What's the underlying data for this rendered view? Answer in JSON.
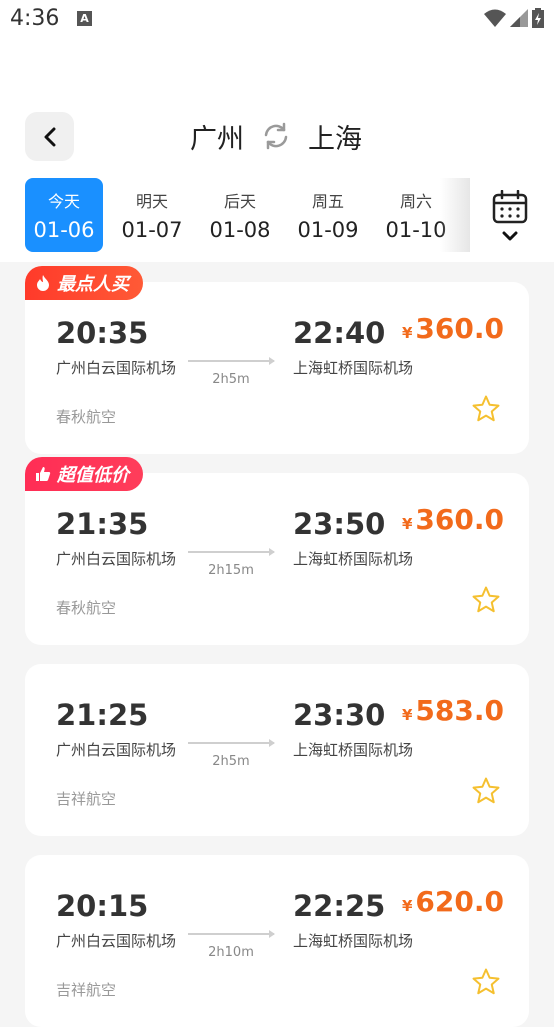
{
  "status_bar": {
    "time": "4:36",
    "notif_icon": "A"
  },
  "header": {
    "origin": "广州",
    "destination": "上海"
  },
  "date_tabs": [
    {
      "label": "今天",
      "date": "01-06",
      "active": true
    },
    {
      "label": "明天",
      "date": "01-07"
    },
    {
      "label": "后天",
      "date": "01-08"
    },
    {
      "label": "周五",
      "date": "01-09"
    },
    {
      "label": "周六",
      "date": "01-10"
    }
  ],
  "flights": [
    {
      "badge": "最点人买",
      "dep_time": "20:35",
      "arr_time": "22:40",
      "dep_airport": "广州白云国际机场",
      "arr_airport": "上海虹桥国际机场",
      "duration": "2h5m",
      "airline": "春秋航空",
      "currency": "¥",
      "price": "360.0"
    },
    {
      "badge": "超值低价",
      "dep_time": "21:35",
      "arr_time": "23:50",
      "dep_airport": "广州白云国际机场",
      "arr_airport": "上海虹桥国际机场",
      "duration": "2h15m",
      "airline": "春秋航空",
      "currency": "¥",
      "price": "360.0"
    },
    {
      "dep_time": "21:25",
      "arr_time": "23:30",
      "dep_airport": "广州白云国际机场",
      "arr_airport": "上海虹桥国际机场",
      "duration": "2h5m",
      "airline": "吉祥航空",
      "currency": "¥",
      "price": "583.0"
    },
    {
      "dep_time": "20:15",
      "arr_time": "22:25",
      "dep_airport": "广州白云国际机场",
      "arr_airport": "上海虹桥国际机场",
      "duration": "2h10m",
      "airline": "吉祥航空",
      "currency": "¥",
      "price": "620.0"
    }
  ],
  "colors": {
    "accent": "#1a90ff",
    "price": "#f26a1b",
    "badge_hot": "#ff3a2a",
    "badge_value": "#ff2d55",
    "star": "#f5c030"
  }
}
